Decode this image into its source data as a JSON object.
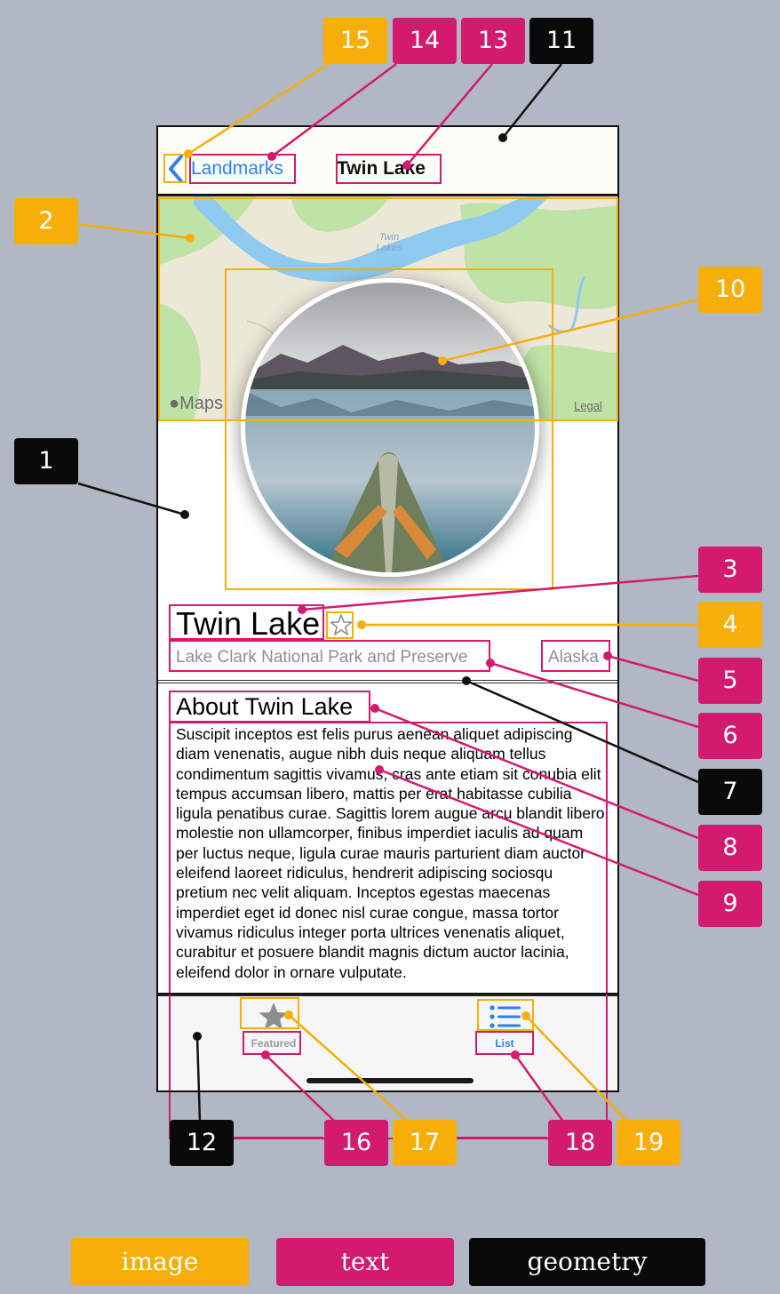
{
  "nav": {
    "back_label": "Landmarks",
    "title": "Twin Lake"
  },
  "map": {
    "place_label": "Twin Lakes",
    "maps_logo": "Maps",
    "legal": "Legal",
    "colors": {
      "land": "#ece8d8",
      "park": "#bfe3a6",
      "water": "#8ec9ef"
    }
  },
  "landmark": {
    "name": "Twin Lake",
    "park": "Lake Clark National Park and Preserve",
    "state": "Alaska",
    "is_favorite": false,
    "about_heading": "About Twin Lake",
    "description": "Suscipit inceptos est felis purus aenean aliquet adipiscing diam venenatis, augue nibh duis neque aliquam tellus condimentum sagittis vivamus, cras ante etiam sit conubia elit tempus accumsan libero, mattis per erat habitasse cubilia ligula penatibus curae. Sagittis lorem augue arcu blandit libero molestie non ullamcorper, finibus imperdiet iaculis ad quam per luctus neque, ligula curae mauris parturient diam auctor eleifend laoreet ridiculus, hendrerit adipiscing sociosqu pretium nec velit aliquam. Inceptos egestas maecenas imperdiet eget id donec nisl curae congue, massa tortor vivamus ridiculus integer porta ultrices venenatis aliquet, curabitur et posuere blandit magnis dictum auctor lacinia, eleifend dolor in ornare vulputate."
  },
  "tabbar": {
    "tabs": [
      {
        "label": "Featured",
        "icon": "star-icon",
        "selected": false
      },
      {
        "label": "List",
        "icon": "list-icon",
        "selected": true
      }
    ],
    "accent": "#2f7ff0",
    "inactive": "#9a9a9a"
  },
  "annotations": {
    "callouts": [
      "1",
      "2",
      "3",
      "4",
      "5",
      "6",
      "7",
      "8",
      "9",
      "10",
      "11",
      "12",
      "13",
      "14",
      "15",
      "16",
      "17",
      "18",
      "19"
    ],
    "legend": {
      "image": "image",
      "text": "text",
      "geometry": "geometry"
    },
    "colors": {
      "image": "#f6ae0a",
      "text": "#d21a6f",
      "geometry": "#0a0a0a"
    }
  }
}
